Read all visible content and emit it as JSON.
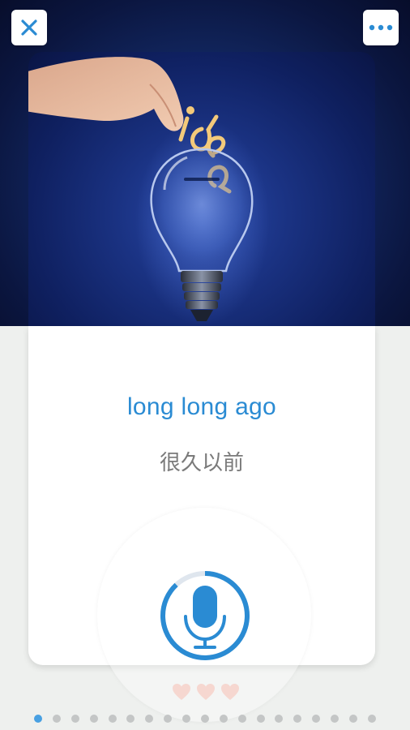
{
  "card": {
    "word": "long long ago",
    "translation": "很久以前",
    "image_subject": "light-bulb-idea-image"
  },
  "top_bar": {
    "close_icon": "close-icon",
    "more_icon": "more-dots-icon"
  },
  "colors": {
    "accent": "#2a8bd3",
    "close_icon": "#2a8bd3",
    "heart": "#f6d7d0",
    "dot_inactive": "#c4c6c6",
    "dot_active": "#48a0e2"
  },
  "lives": {
    "hearts": 3
  },
  "progress": {
    "total_pages": 19,
    "current_page": 1
  },
  "mic": {
    "progress_fraction": 0.88
  }
}
